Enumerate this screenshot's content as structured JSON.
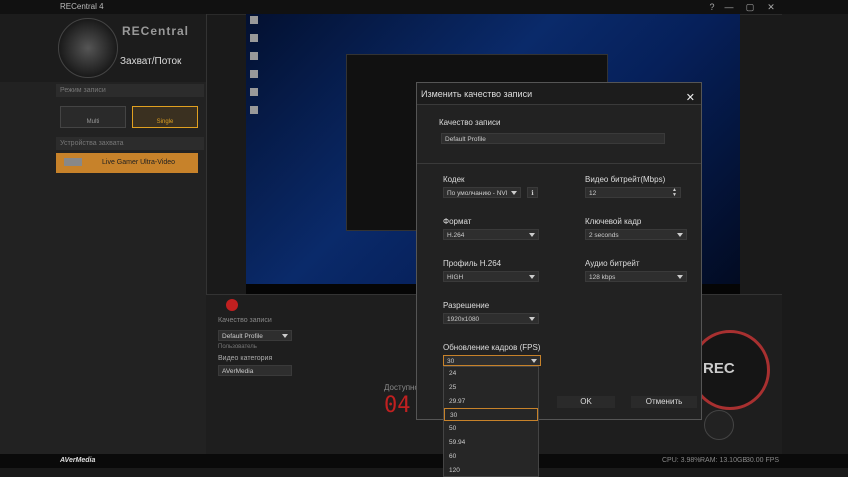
{
  "window": {
    "title": "RECentral 4",
    "btn_help": "?",
    "btn_min": "—",
    "btn_max": "▢",
    "btn_close": "✕"
  },
  "sidebar": {
    "brand": "RECentral",
    "mode": "Захват/Поток",
    "record_mode_label": "Режим записи",
    "mode_multi": "Multi",
    "mode_single": "Single",
    "devices_label": "Устройства захвата",
    "device_name": "Live Gamer Ultra-Video"
  },
  "bottom": {
    "quality_label": "Качество записи",
    "profile": "Default Profile",
    "sub_label": "Пользователь",
    "video_category_label": "Видео категория",
    "category_value": "AVerMedia",
    "avail_label": "Доступно",
    "counter": "04",
    "rec": "REC"
  },
  "status": {
    "brand": "AVerMedia",
    "cpu": "CPU: 3.98%",
    "ram": "RAM: 13.10GB",
    "fps": "30.00 FPS"
  },
  "dialog": {
    "title": "Изменить качество записи",
    "quality_label": "Качество записи",
    "quality_value": "Default Profile",
    "codec_label": "Кодек",
    "codec_value": "По умолчанию - NVI",
    "video_bitrate_label": "Видео битрейт(Mbps)",
    "video_bitrate_value": "12",
    "format_label": "Формат",
    "format_value": "H.264",
    "keyframe_label": "Ключевой кадр",
    "keyframe_value": "2 seconds",
    "profile_label": "Профиль H.264",
    "profile_value": "HIGH",
    "audio_bitrate_label": "Аудио битрейт",
    "audio_bitrate_value": "128 kbps",
    "resolution_label": "Разрешение",
    "resolution_value": "1920x1080",
    "fps_label": "Обновление кадров (FPS)",
    "fps_value": "30",
    "ok": "OK",
    "cancel": "Отменить"
  },
  "fps_options": [
    "24",
    "25",
    "29.97",
    "30",
    "50",
    "59.94",
    "60",
    "120"
  ]
}
